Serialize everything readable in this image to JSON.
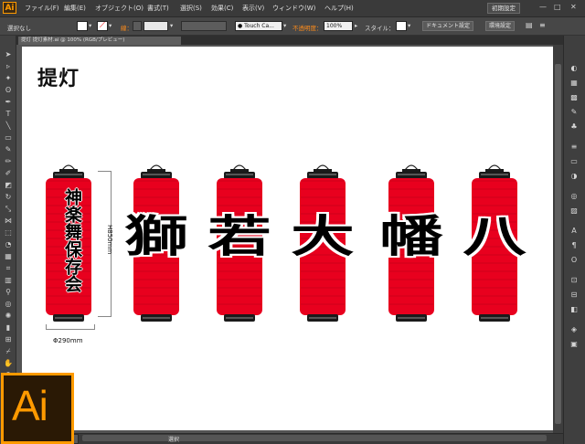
{
  "app": {
    "logo_small": "Ai",
    "logo_big": "Ai",
    "workspace_button": "初期設定"
  },
  "menu": {
    "items": [
      "ファイル(F)",
      "編集(E)",
      "オブジェクト(O)",
      "書式(T)",
      "選択(S)",
      "効果(C)",
      "表示(V)",
      "ウィンドウ(W)",
      "ヘルプ(H)"
    ]
  },
  "control_bar": {
    "selection_label": "選択なし",
    "stroke_label": "線：",
    "brush_value": "Touch Ca...",
    "opacity_label": "不透明度：",
    "opacity_value": "100%",
    "style_label": "スタイル：",
    "doc_settings_button": "ドキュメント設定",
    "preferences_button": "環境設定"
  },
  "document": {
    "tab_title": "提灯 提灯素材.ai @ 100% (RGB/プレビュー)",
    "heading": "提灯"
  },
  "artwork": {
    "dimension_height": "H850mm",
    "dimension_width": "Φ290mm",
    "lanterns": [
      {
        "text": "神楽舞保存会",
        "vertical": true
      },
      {
        "text": "獅",
        "vertical": false
      },
      {
        "text": "若",
        "vertical": false
      },
      {
        "text": "大",
        "vertical": false
      },
      {
        "text": "幡",
        "vertical": false
      },
      {
        "text": "八",
        "vertical": false
      }
    ],
    "colors": {
      "lantern_red": "#e8001e",
      "ink": "#000000",
      "cap": "#1a1a1a"
    }
  },
  "status": {
    "tool_label": "選択"
  }
}
